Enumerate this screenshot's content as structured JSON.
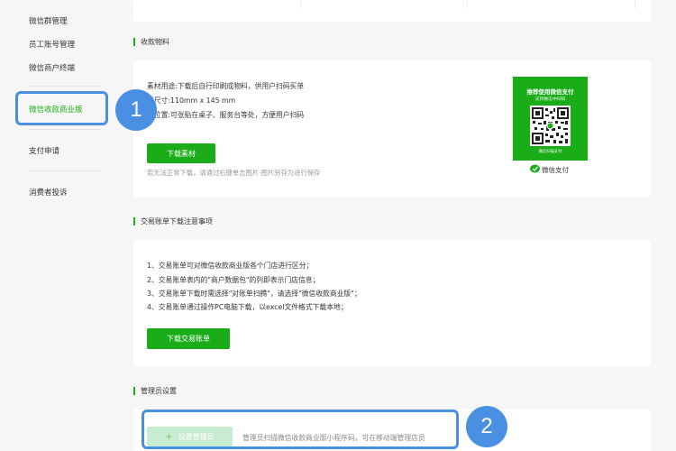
{
  "sidebar": {
    "items": [
      {
        "label": "微信群管理"
      },
      {
        "label": "员工账号管理"
      },
      {
        "label": "微信商户终端"
      },
      {
        "label": "微信收款商业版"
      },
      {
        "label": "支付申请"
      },
      {
        "label": "消费者投诉"
      }
    ]
  },
  "callouts": {
    "one": "1",
    "two": "2"
  },
  "materials": {
    "title": "收款物料",
    "usage": "素材用途:下载后自行印刷成物料，供用户扫码买单",
    "size": "料尺寸:110mm x 145 mm",
    "placement": "放位置:可张贴在桌子、服务台等处，方便用户扫码",
    "download_button": "下载素材",
    "hint": "若无法正常下载，请通过右键单击图片-图片另存为进行保存",
    "poster_title": "推荐使用微信支付",
    "poster_subtitle": "支持微信中扫码",
    "poster_footer": "微信扫描支付",
    "wechat_pay_label": "微信支付"
  },
  "bill": {
    "title": "交易账单下载注意事项",
    "notes": [
      "1、交易账单可对微信收款商业版各个门店进行区分；",
      "2、交易账单表内的\"商户数据包\"的列即表示门店信息；",
      "3、交易账单下载时需选择\"对账单扫腾\"，请选择\"微信收款商业版\"；",
      "4、交易账单通过操作PC电脑下载，以excel文件格式下载本地；"
    ],
    "download_button": "下载交易账单"
  },
  "admin": {
    "title": "管理员设置",
    "set_button": "设置管理员",
    "desc": "管理员扫描微信收款商业版小程序码，可在移动端管理店员"
  },
  "colors": {
    "accent": "#1aad19",
    "callout": "#4a90e2"
  }
}
